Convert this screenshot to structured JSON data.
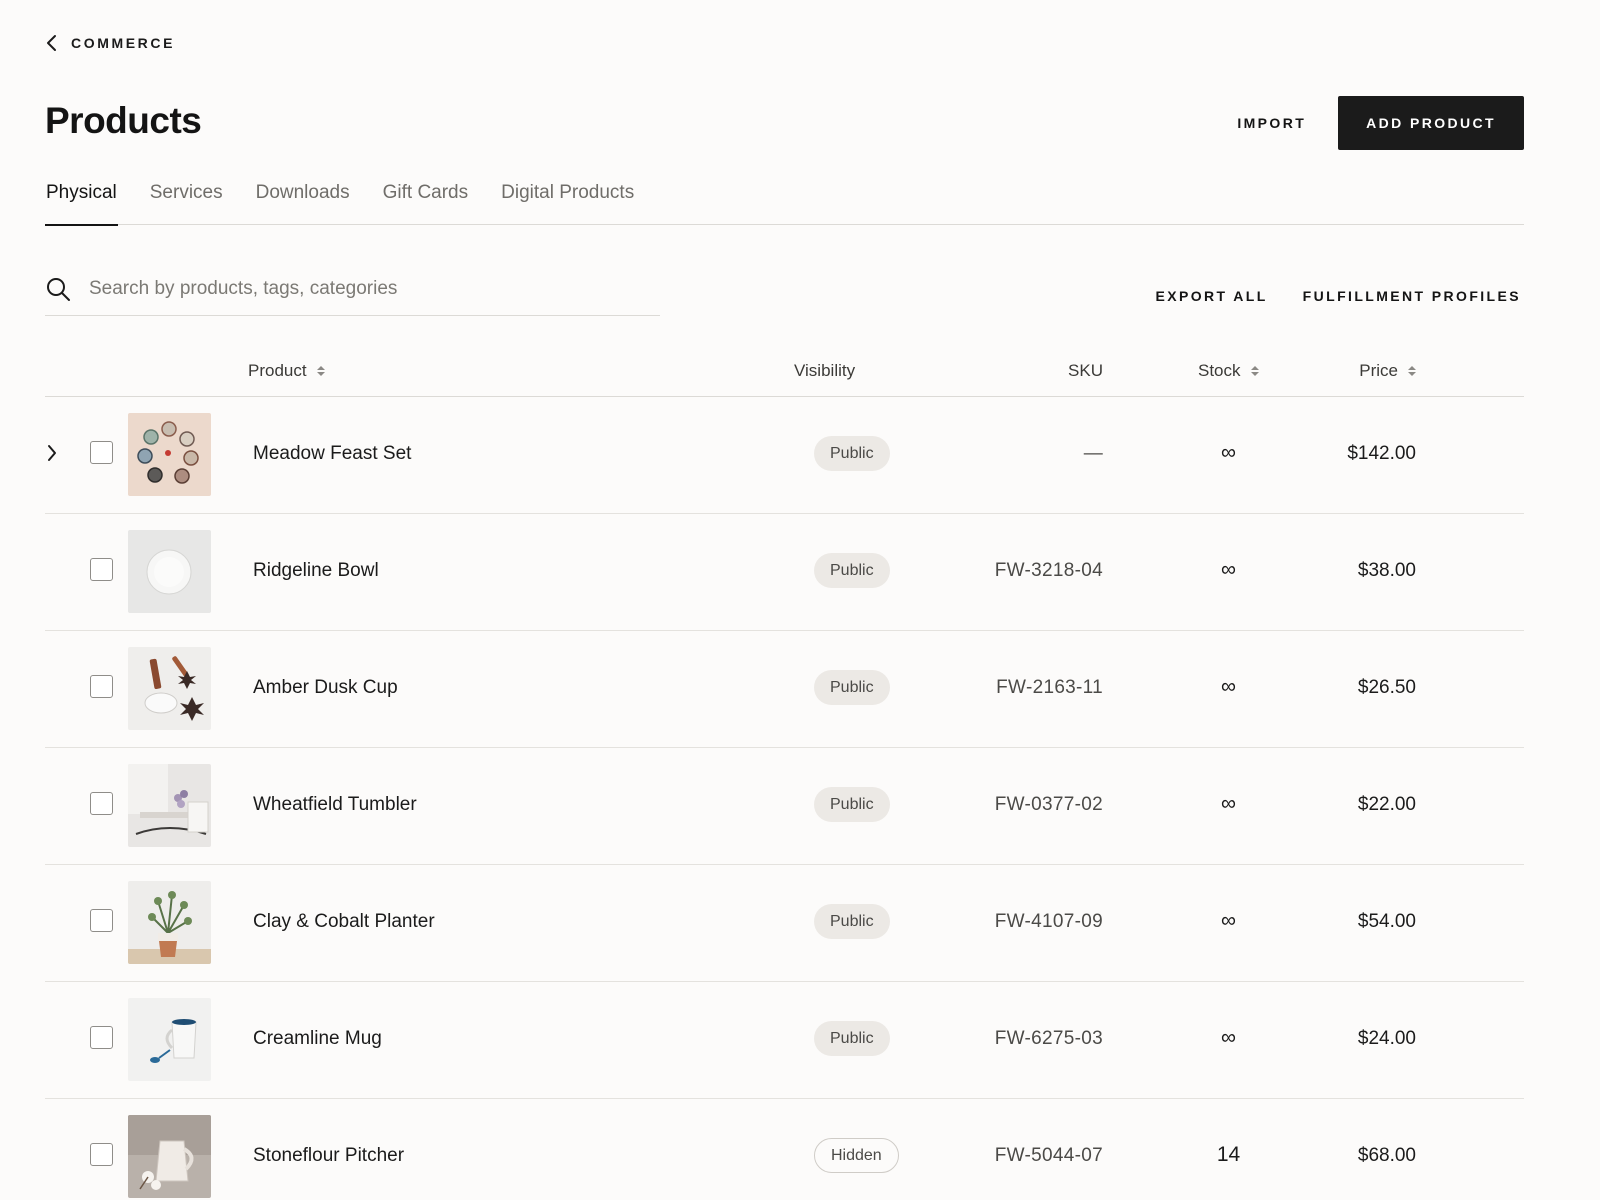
{
  "nav": {
    "back_label": "COMMERCE"
  },
  "header": {
    "title": "Products",
    "import_label": "IMPORT",
    "add_label": "ADD PRODUCT"
  },
  "tabs": [
    {
      "label": "Physical",
      "active": true
    },
    {
      "label": "Services"
    },
    {
      "label": "Downloads"
    },
    {
      "label": "Gift Cards"
    },
    {
      "label": "Digital Products"
    }
  ],
  "search": {
    "placeholder": "Search by products, tags, categories",
    "value": ""
  },
  "toolbar": {
    "export_label": "EXPORT ALL",
    "fulfillment_label": "FULFILLMENT PROFILES"
  },
  "table": {
    "columns": {
      "product": "Product",
      "visibility": "Visibility",
      "sku": "SKU",
      "stock": "Stock",
      "price": "Price"
    },
    "rows": [
      {
        "name": "Meadow Feast Set",
        "visibility": "Public",
        "sku": "—",
        "stock": "∞",
        "price": "$142.00",
        "thumb": "plates-icon",
        "expandable": true
      },
      {
        "name": "Ridgeline Bowl",
        "visibility": "Public",
        "sku": "FW-3218-04",
        "stock": "∞",
        "price": "$38.00",
        "thumb": "bowl-icon"
      },
      {
        "name": "Amber Dusk Cup",
        "visibility": "Public",
        "sku": "FW-2163-11",
        "stock": "∞",
        "price": "$26.50",
        "thumb": "cup-icon"
      },
      {
        "name": "Wheatfield Tumbler",
        "visibility": "Public",
        "sku": "FW-0377-02",
        "stock": "∞",
        "price": "$22.00",
        "thumb": "tumbler-icon"
      },
      {
        "name": "Clay & Cobalt Planter",
        "visibility": "Public",
        "sku": "FW-4107-09",
        "stock": "∞",
        "price": "$54.00",
        "thumb": "planter-icon"
      },
      {
        "name": "Creamline Mug",
        "visibility": "Public",
        "sku": "FW-6275-03",
        "stock": "∞",
        "price": "$24.00",
        "thumb": "mug-icon"
      },
      {
        "name": "Stoneflour Pitcher",
        "visibility": "Hidden",
        "sku": "FW-5044-07",
        "stock": "14",
        "price": "$68.00",
        "thumb": "pitcher-icon"
      }
    ]
  }
}
